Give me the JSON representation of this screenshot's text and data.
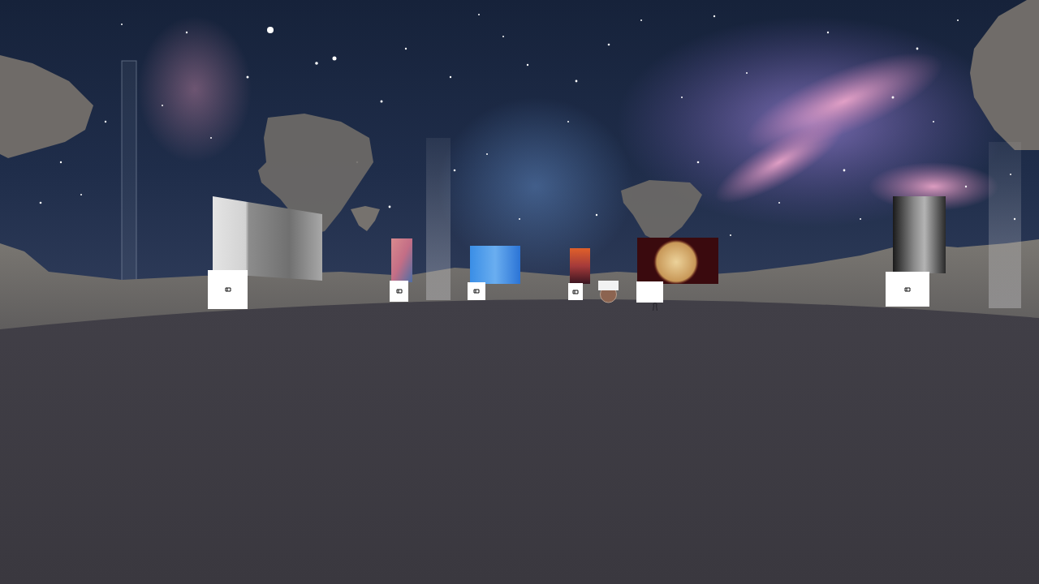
{
  "exhibits": [
    {
      "kind": "artwork"
    },
    {
      "kind": "placard"
    },
    {
      "kind": "artwork"
    },
    {
      "kind": "placard"
    },
    {
      "kind": "artwork"
    },
    {
      "kind": "placard"
    },
    {
      "kind": "artwork"
    },
    {
      "kind": "placard"
    },
    {
      "kind": "plaque"
    },
    {
      "kind": "artwork"
    },
    {
      "kind": "blankcard"
    },
    {
      "kind": "artwork"
    },
    {
      "kind": "placard"
    }
  ]
}
